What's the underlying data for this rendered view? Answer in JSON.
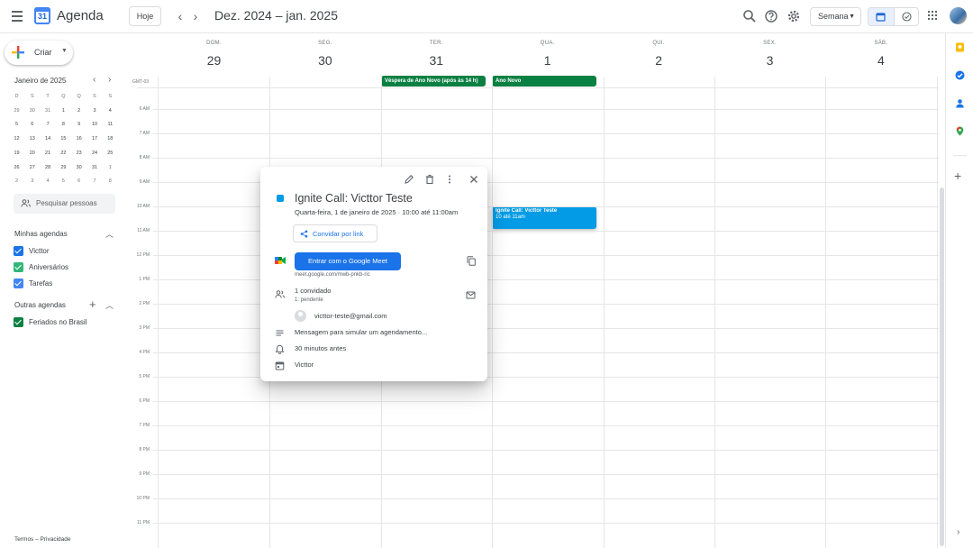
{
  "header": {
    "logo_day": "31",
    "app_title": "Agenda",
    "today_label": "Hoje",
    "prev_label": "‹",
    "next_label": "›",
    "range_title": "Dez. 2024 – jan. 2025",
    "view_label": "Semana"
  },
  "sidebar": {
    "create_label": "Criar",
    "mini_calendar": {
      "title": "Janeiro de 2025",
      "weekdays": [
        "D",
        "S",
        "T",
        "Q",
        "Q",
        "S",
        "S"
      ],
      "weeks": [
        [
          "29",
          "30",
          "31",
          "1",
          "2",
          "3",
          "4"
        ],
        [
          "5",
          "6",
          "7",
          "8",
          "9",
          "10",
          "11"
        ],
        [
          "12",
          "13",
          "14",
          "15",
          "16",
          "17",
          "18"
        ],
        [
          "19",
          "20",
          "21",
          "22",
          "23",
          "24",
          "25"
        ],
        [
          "26",
          "27",
          "28",
          "29",
          "30",
          "31",
          "1"
        ],
        [
          "2",
          "3",
          "4",
          "5",
          "6",
          "7",
          "8"
        ]
      ],
      "selected": "1"
    },
    "people_search_placeholder": "Pesquisar pessoas",
    "my_calendars_title": "Minhas agendas",
    "my_calendars": [
      {
        "label": "Victtor",
        "color": "#1a73e8"
      },
      {
        "label": "Aniversários",
        "color": "#33b679"
      },
      {
        "label": "Tarefas",
        "color": "#4285f4"
      }
    ],
    "other_calendars_title": "Outras agendas",
    "other_calendars": [
      {
        "label": "Feriados no Brasil",
        "color": "#0b8043"
      }
    ],
    "footer": "Termos – Privacidade"
  },
  "week": {
    "timezone": "GMT-03",
    "days": [
      {
        "name": "DOM.",
        "num": "29"
      },
      {
        "name": "SEG.",
        "num": "30"
      },
      {
        "name": "TER.",
        "num": "31"
      },
      {
        "name": "QUA.",
        "num": "1"
      },
      {
        "name": "QUI.",
        "num": "2"
      },
      {
        "name": "SEX.",
        "num": "3"
      },
      {
        "name": "SÁB.",
        "num": "4"
      }
    ],
    "hours": [
      "6 AM",
      "7 AM",
      "8 AM",
      "9 AM",
      "10 AM",
      "11 AM",
      "12 PM",
      "1 PM",
      "2 PM",
      "3 PM",
      "4 PM",
      "5 PM",
      "6 PM",
      "7 PM",
      "8 PM",
      "9 PM",
      "10 PM",
      "11 PM"
    ],
    "allday_events": [
      {
        "title": "Véspera de Ano Novo (após às 14 h)",
        "color": "#0b8043"
      },
      {
        "title": "Ano Novo",
        "color": "#0b8043"
      }
    ],
    "timed_event": {
      "title": "Ignite Call: Victtor Teste",
      "time": "10 até 11am",
      "color": "#039be5"
    }
  },
  "popup": {
    "title": "Ignite Call: Victtor Teste",
    "datetime": "Quarta-feira, 1 de janeiro de 2025  ·  10:00 até 11:00am",
    "invite_label": "Convidar por link",
    "meet_label": "Entrar com o Google Meet",
    "meet_link": "meet.google.com/mwb-pnkb-ric",
    "guests_count": "1 convidado",
    "guests_status": "1: pendente",
    "guest_email": "victtor-teste@gmail.com",
    "description": "Mensagem para simular um agendamento...",
    "reminder": "30 minutos antes",
    "organizer": "Victtor"
  }
}
